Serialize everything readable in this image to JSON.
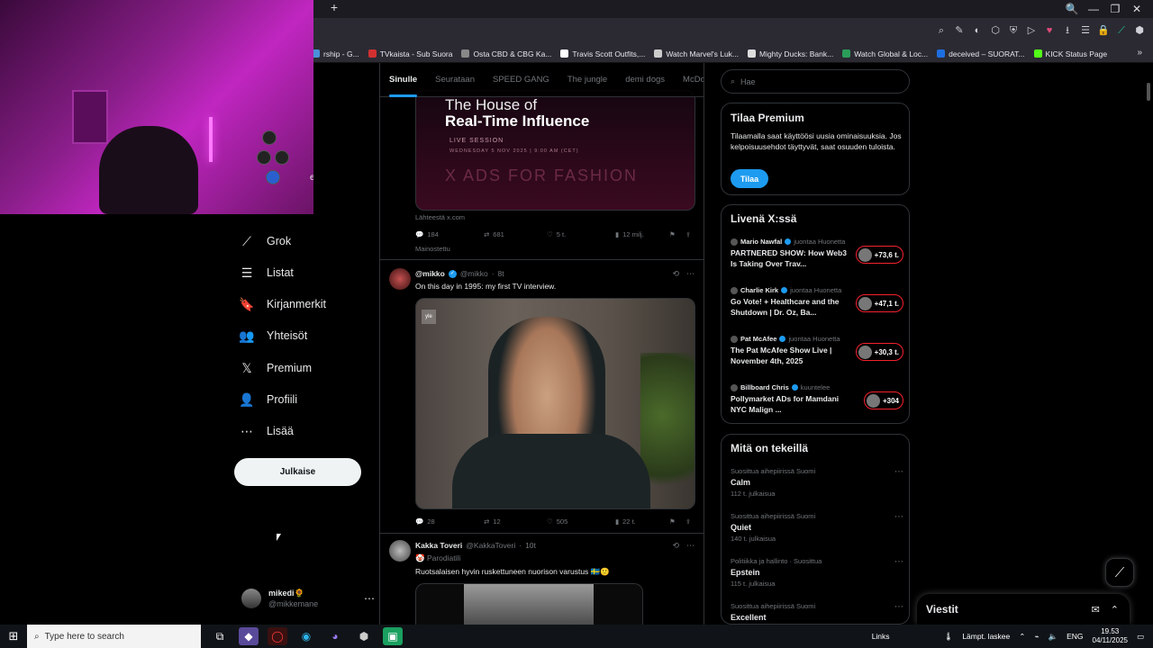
{
  "browser": {
    "new_tab_glyph": "+",
    "window_controls": [
      "🔍",
      "—",
      "❐",
      "✕"
    ],
    "toolbar_icons": [
      "⌕",
      "✎",
      "◐",
      "⬡",
      "⛨",
      "▷",
      "♥",
      "⭳",
      "☰",
      "🔒",
      "⟋",
      "⬢"
    ],
    "bookmarks": [
      {
        "label": "rship - G...",
        "color": "#4a90d9"
      },
      {
        "label": "TVkaista - Sub Suora",
        "color": "#d03030"
      },
      {
        "label": "Osta CBD & CBG Ka...",
        "color": "#888888"
      },
      {
        "label": "Travis Scott Outfits,...",
        "color": "#ffffff"
      },
      {
        "label": "Watch Marvel's Luk...",
        "color": "#cccccc"
      },
      {
        "label": "Mighty Ducks: Bank...",
        "color": "#dddddd"
      },
      {
        "label": "Watch Global & Loc...",
        "color": "#2a9d5a"
      },
      {
        "label": "deceived – SUORAT...",
        "color": "#1d6fe0"
      },
      {
        "label": "KICK Status Page",
        "color": "#53fc18"
      }
    ],
    "bookmarks_more": "»"
  },
  "webcam": {
    "partial_label": "et"
  },
  "nav": {
    "items": [
      {
        "label": "Grok",
        "icon": "grok-icon",
        "glyph": "⟋"
      },
      {
        "label": "Listat",
        "icon": "list-icon",
        "glyph": "☰"
      },
      {
        "label": "Kirjanmerkit",
        "icon": "bookmark-icon",
        "glyph": "🔖"
      },
      {
        "label": "Yhteisöt",
        "icon": "communities-icon",
        "glyph": "👥"
      },
      {
        "label": "Premium",
        "icon": "x-logo-icon",
        "glyph": "𝕏"
      },
      {
        "label": "Profiili",
        "icon": "profile-icon",
        "glyph": "👤"
      },
      {
        "label": "Lisää",
        "icon": "more-circle-icon",
        "glyph": "⋯"
      }
    ],
    "post_button": "Julkaise",
    "account": {
      "name": "mikedi🌻",
      "handle": "@mikkemane",
      "more": "⋯"
    }
  },
  "feed": {
    "tabs": [
      "Sinulle",
      "Seurataan",
      "SPEED GANG",
      "The jungle",
      "demi dogs",
      "McDonal"
    ],
    "ad": {
      "line1": "The House of",
      "line2": "Real-Time Influence",
      "line3": "LIVE SESSION",
      "line4": "WEDNESDAY 5 NOV 2025 | 9:00 AM (CET)",
      "line5": "X ADS FOR FASHION",
      "source": "Lähteestä x.com",
      "replies": "184",
      "reposts": "681",
      "likes": "5 t.",
      "views": "12 milj.",
      "promoted": "Mainostettu"
    },
    "posts": [
      {
        "display_name": "@mikko",
        "handle": "@mikko",
        "time": "8t",
        "text": "On this day in 1995: my first TV interview.",
        "media_badge": "yle",
        "replies": "28",
        "reposts": "12",
        "likes": "505",
        "views": "22 t."
      },
      {
        "display_name": "Kakka Toveri",
        "handle": "@KakkaToveri",
        "time": "10t",
        "label": "🤡 Parodiatili",
        "text": "Ruotsalaisen hyvin ruskettuneen nuorison varustus 🇸🇪🙂"
      }
    ]
  },
  "sidebar": {
    "search_placeholder": "Hae",
    "premium": {
      "title": "Tilaa Premium",
      "desc": "Tilaamalla saat käyttöösi uusia ominaisuuksia. Jos kelpoisuusehdot täyttyvät, saat osuuden tuloista.",
      "button": "Tilaa"
    },
    "live": {
      "title": "Livenä X:ssä",
      "items": [
        {
          "host": "Mario Nawfal",
          "status": "juontaa Huonetta",
          "title": "PARTNERED SHOW: How Web3 Is Taking Over Trav...",
          "count": "+73,6 t."
        },
        {
          "host": "Charlie Kirk",
          "status": "juontaa Huonetta",
          "title": "Go Vote! + Healthcare and the Shutdown | Dr. Oz, Ba...",
          "count": "+47,1 t."
        },
        {
          "host": "Pat McAfee",
          "status": "juontaa Huonetta",
          "title": "The Pat McAfee Show Live | November 4th, 2025",
          "count": "+30,3 t."
        },
        {
          "host": "Billboard Chris",
          "status": "kuuntelee",
          "title": "Pollymarket ADs for Mamdani NYC Malign ...",
          "count": "+304"
        }
      ]
    },
    "trends": {
      "title": "Mitä on tekeillä",
      "items": [
        {
          "context": "Suosittua aihepiirissä Suomi",
          "name": "Calm",
          "count": "112 t. julkaisua"
        },
        {
          "context": "Suosittua aihepiirissä Suomi",
          "name": "Quiet",
          "count": "140 t. julkaisua"
        },
        {
          "context": "Politiikka ja hallinto · Suosittua",
          "name": "Epstein",
          "count": "115 t. julkaisua"
        },
        {
          "context": "Suosittua aihepiirissä Suomi",
          "name": "Excellent",
          "count": ""
        }
      ]
    },
    "messages_title": "Viestit"
  },
  "taskbar": {
    "search_placeholder": "Type here to search",
    "links": "Links",
    "weather": "Lämpt. laskee",
    "lang": "ENG",
    "time": "19.53",
    "date": "04/11/2025"
  }
}
